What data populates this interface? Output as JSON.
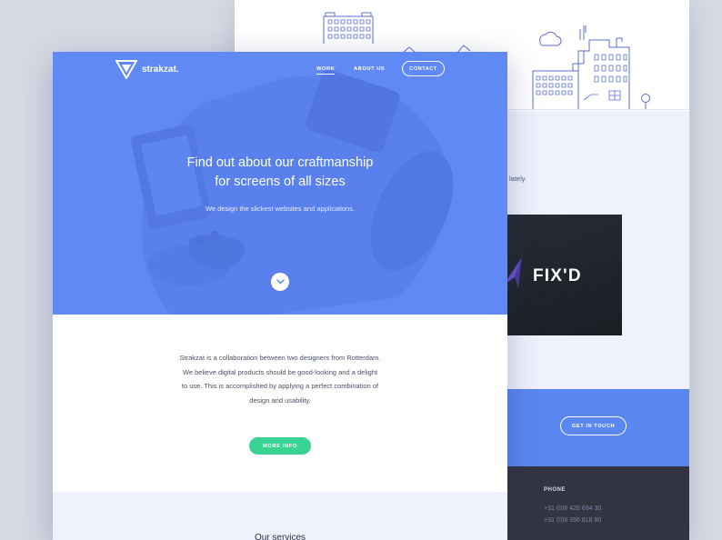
{
  "back_page": {
    "lately_text": "lately.",
    "card_brand": "FIX'D",
    "cta_label": "GET IN TOUCH",
    "footer": {
      "phone_label": "PHONE",
      "phone_1": "+31 (0)6 426 694 30",
      "phone_2": "+31 (0)6 396 618 80"
    }
  },
  "front_page": {
    "nav": {
      "logo_text": "strakzat.",
      "work": "WORK",
      "about": "ABOUT US",
      "contact": "CONTACT"
    },
    "hero": {
      "title_line1": "Find out about our craftmanship",
      "title_line2": "for screens of all sizes",
      "subtitle": "We design the slickest websites and applications."
    },
    "about": {
      "line1": "Strakzat is a collaboration between two designers from Rotterdam.",
      "line2": "We believe digital products should be good-looking and a delight",
      "line3": "to use. This is accomplished by applying a perfect combination of",
      "line4": "design and usability."
    },
    "more_info": "MORE INFO",
    "services_title": "Our services"
  },
  "colors": {
    "brand_blue": "#5b87f3",
    "accent_green": "#39d392",
    "footer_dark": "#333542",
    "light_band": "#eff2fd"
  },
  "icons": [
    "logo-triangle-icon",
    "chevron-down-icon",
    "city-illustration",
    "fixd-logo-icon"
  ]
}
